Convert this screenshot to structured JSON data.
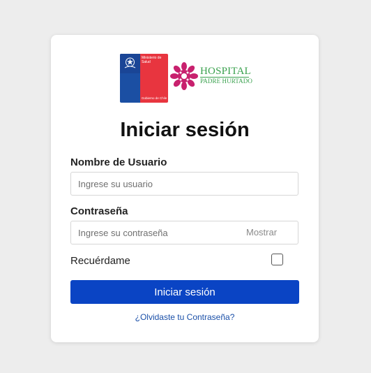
{
  "logos": {
    "ministry_text": "Ministerio de\nSalud",
    "government_text": "Gobierno de Chile",
    "hospital_line1": "HOSPITAL",
    "hospital_line2": "PADRE HURTADO"
  },
  "login": {
    "title": "Iniciar sesión",
    "username_label": "Nombre de Usuario",
    "username_placeholder": "Ingrese su usuario",
    "username_value": "",
    "password_label": "Contraseña",
    "password_placeholder": "Ingrese su contraseña",
    "password_value": "",
    "show_password_label": "Mostrar",
    "remember_label": "Recuérdame",
    "remember_checked": false,
    "submit_label": "Iniciar sesión",
    "forgot_link": "¿Olvidaste tu Contraseña?"
  },
  "colors": {
    "page_background": "#ededed",
    "primary_button": "#0a44c4",
    "link": "#1a4fa8",
    "ministry_blue": "#1b4fa3",
    "ministry_red": "#e8353f",
    "hospital_green": "#3aa14e",
    "hospital_magenta": "#c8216e"
  }
}
